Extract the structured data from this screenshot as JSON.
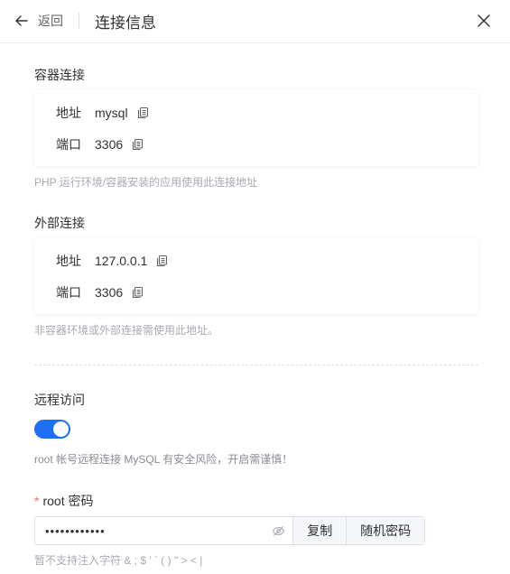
{
  "header": {
    "back_label": "返回",
    "title": "连接信息"
  },
  "container": {
    "title": "容器连接",
    "address_key": "地址",
    "address_value": "mysql",
    "port_key": "端口",
    "port_value": "3306",
    "help": "PHP 运行环境/容器安装的应用使用此连接地址"
  },
  "external": {
    "title": "外部连接",
    "address_key": "地址",
    "address_value": "127.0.0.1",
    "port_key": "端口",
    "port_value": "3306",
    "help": "非容器环境或外部连接需使用此地址。"
  },
  "remote": {
    "title": "远程访问",
    "enabled": true,
    "warning": "root 帐号远程连接 MySQL 有安全风险，开启需谨慎！"
  },
  "password": {
    "required_mark": "*",
    "label": "root 密码",
    "value": "••••••••••••",
    "copy_label": "复制",
    "random_label": "随机密码",
    "note": "暂不支持注入字符 & ; $ ' ` ( ) \" > < |"
  },
  "colors": {
    "accent": "#1e6ff1",
    "required": "#f56c6c"
  }
}
